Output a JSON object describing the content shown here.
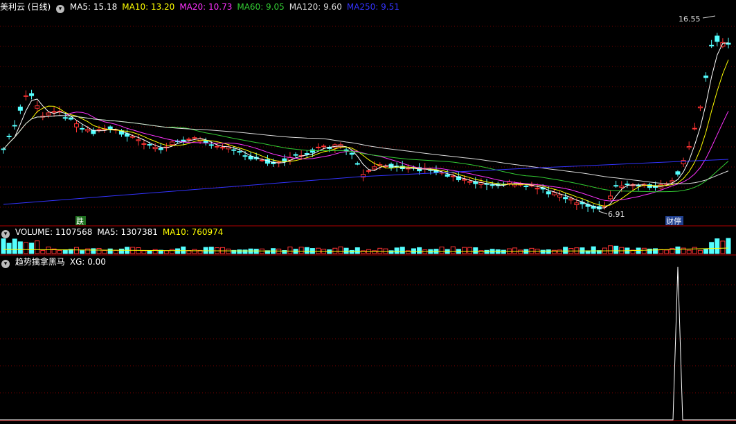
{
  "stock": {
    "title": "美利云 (日线)"
  },
  "price_panel": {
    "ma_labels": [
      {
        "text": "MA5: 15.18",
        "color": "#ffffff"
      },
      {
        "text": "MA10: 13.20",
        "color": "#ffff00"
      },
      {
        "text": "MA20: 10.73",
        "color": "#ff33ff"
      },
      {
        "text": "MA60: 9.05",
        "color": "#33cc33"
      },
      {
        "text": "MA120: 9.60",
        "color": "#dddddd"
      },
      {
        "text": "MA250: 9.51",
        "color": "#3333ff"
      }
    ],
    "high_label": "16.55",
    "low_label": "6.91",
    "marker_left": "跌",
    "marker_right": "财停"
  },
  "volume_panel": {
    "labels": [
      {
        "text": "VOLUME: 1107568",
        "color": "#ffffff"
      },
      {
        "text": "MA5: 1307381",
        "color": "#ffffff"
      },
      {
        "text": "MA10: 760974",
        "color": "#ffff00"
      }
    ]
  },
  "indicator_panel": {
    "labels": [
      {
        "text": "趋势擒拿黑马",
        "color": "#ffffff"
      },
      {
        "text": "XG: 0.00",
        "color": "#ffffff"
      }
    ]
  },
  "colors": {
    "up": "#ff3333",
    "down": "#54ffff",
    "grid": "#7a0000",
    "ma5": "#ffffff",
    "ma10": "#ffff00",
    "ma20": "#ff33ff",
    "ma60": "#33cc33",
    "ma120": "#dddddd",
    "ma250": "#3333ff"
  }
}
